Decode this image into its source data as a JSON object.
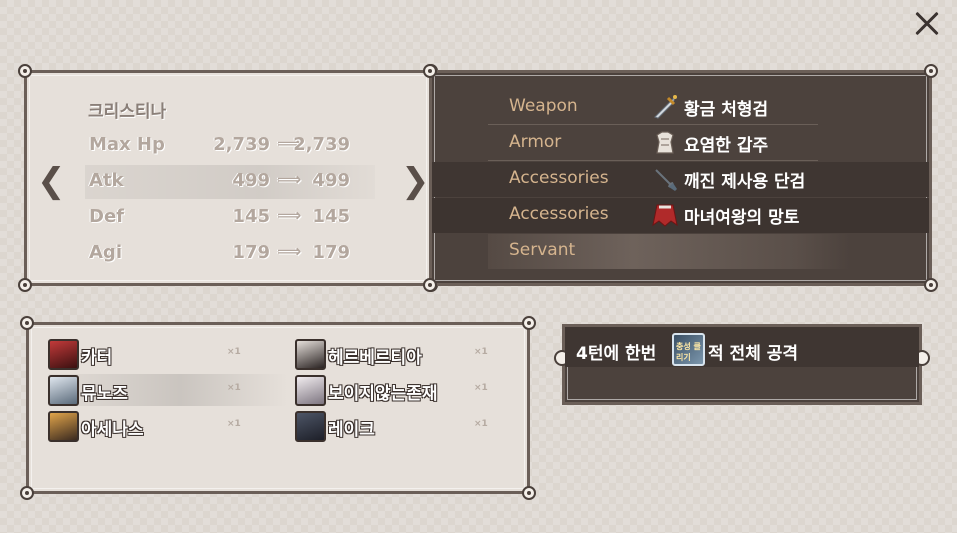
{
  "close_label": "close",
  "stats": {
    "character_name": "크리스티나",
    "rows": [
      {
        "label": "Max Hp",
        "from": "2,739",
        "arrow": "⟹",
        "to": "2,739"
      },
      {
        "label": "Atk",
        "from": "499",
        "arrow": "⟹",
        "to": "499"
      },
      {
        "label": "Def",
        "from": "145",
        "arrow": "⟹",
        "to": "145"
      },
      {
        "label": "Agi",
        "from": "179",
        "arrow": "⟹",
        "to": "179"
      }
    ],
    "prev_glyph": "❮",
    "next_glyph": "❯"
  },
  "equipment": {
    "slots": [
      {
        "slot": "Weapon",
        "item": "황금 처형검",
        "icon": "sword-icon"
      },
      {
        "slot": "Armor",
        "item": "요염한 갑주",
        "icon": "armor-icon"
      },
      {
        "slot": "Accessories",
        "item": "깨진 제사용 단검",
        "icon": "dagger-icon"
      },
      {
        "slot": "Accessories",
        "item": "마녀여왕의 망토",
        "icon": "cape-icon"
      }
    ],
    "servant_label": "Servant"
  },
  "servants": [
    {
      "name": "카터",
      "count": "×1"
    },
    {
      "name": "헤르베르티아",
      "count": "×1"
    },
    {
      "name": "뮤노즈",
      "count": "×1"
    },
    {
      "name": "보이지않는존재",
      "count": "×1"
    },
    {
      "name": "아세나스",
      "count": "×1"
    },
    {
      "name": "레이크",
      "count": "×1"
    }
  ],
  "skill": {
    "prefix": "4턴에 한번",
    "icon_label": "충성 클리기",
    "suffix": "적 전체 공격"
  },
  "colors": {
    "background": "#dcd6cf",
    "dark_panel": "#4c423d",
    "slot_label": "#d5b48e",
    "stat_text": "#b3a79e"
  }
}
